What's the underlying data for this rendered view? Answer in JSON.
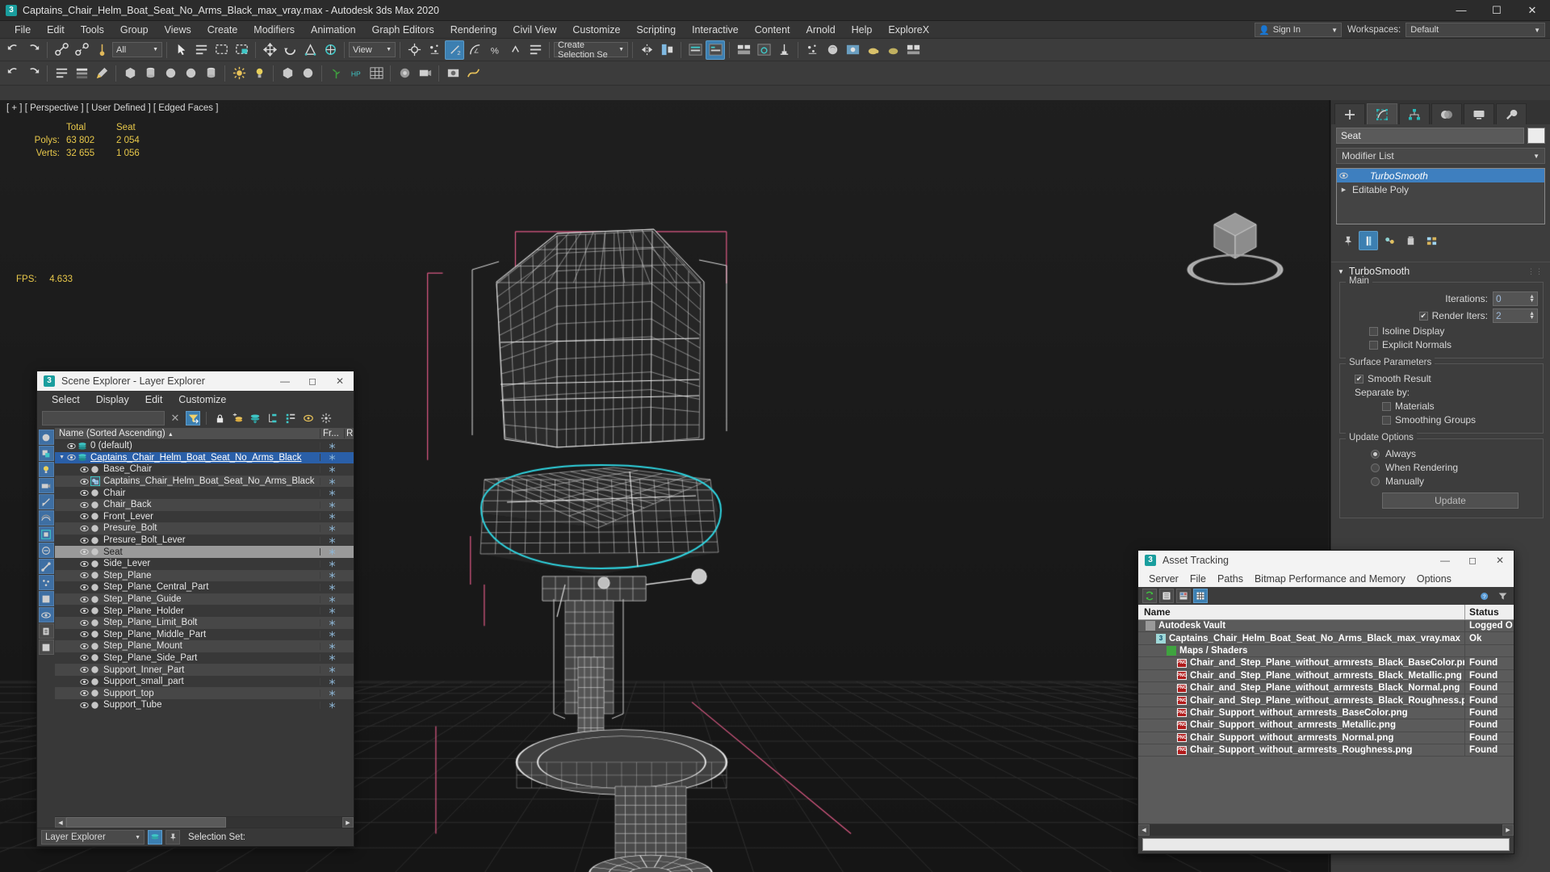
{
  "titlebar": {
    "title": "Captains_Chair_Helm_Boat_Seat_No_Arms_Black_max_vray.max - Autodesk 3ds Max 2020",
    "app_icon": "3",
    "minimize": "—",
    "maximize": "☐",
    "close": "✕"
  },
  "menubar": {
    "items": [
      "File",
      "Edit",
      "Tools",
      "Group",
      "Views",
      "Create",
      "Modifiers",
      "Animation",
      "Graph Editors",
      "Rendering",
      "Civil View",
      "Customize",
      "Scripting",
      "Interactive",
      "Content",
      "Arnold",
      "Help",
      "ExploreX"
    ],
    "signin": "Sign In",
    "workspaces_label": "Workspaces:",
    "workspace_value": "Default"
  },
  "toolbar": {
    "selection_filter": "All",
    "view_ref": "View",
    "named_selection_set": "Create Selection Se"
  },
  "viewport": {
    "label": "[ + ] [ Perspective ] [ User Defined ] [ Edged Faces ]",
    "stats": {
      "col_total": "Total",
      "col_object": "Seat",
      "polys_label": "Polys:",
      "polys_total": "63 802",
      "polys_object": "2 054",
      "verts_label": "Verts:",
      "verts_total": "32 655",
      "verts_object": "1 056",
      "fps_label": "FPS:",
      "fps_value": "4.633"
    }
  },
  "command_panel": {
    "object_name": "Seat",
    "modifier_list": "Modifier List",
    "stack": [
      {
        "label": "TurboSmooth",
        "selected": true
      },
      {
        "label": "Editable Poly",
        "selected": false
      }
    ],
    "rollout": {
      "title": "TurboSmooth",
      "main_group": "Main",
      "iterations_label": "Iterations:",
      "iterations_value": "0",
      "render_iters_label": "Render Iters:",
      "render_iters_value": "2",
      "render_iters_checked": true,
      "isoline_display": "Isoline Display",
      "explicit_normals": "Explicit Normals",
      "surface_group": "Surface Parameters",
      "smooth_result": "Smooth Result",
      "smooth_result_checked": true,
      "separate_by": "Separate by:",
      "materials": "Materials",
      "smoothing_groups": "Smoothing Groups",
      "update_group": "Update Options",
      "update_always": "Always",
      "update_when_rendering": "When Rendering",
      "update_manually": "Manually",
      "update_selected": "Always",
      "update_button": "Update"
    }
  },
  "scene_explorer": {
    "title": "Scene Explorer - Layer Explorer",
    "menu": [
      "Select",
      "Display",
      "Edit",
      "Customize"
    ],
    "search_value": "",
    "column_name": "Name (Sorted Ascending)",
    "column_freeze": "Fr...",
    "column_render": "R",
    "rows": [
      {
        "name": "0 (default)",
        "indent": 1,
        "type": "layer",
        "state": "normal"
      },
      {
        "name": "Captains_Chair_Helm_Boat_Seat_No_Arms_Black",
        "indent": 1,
        "type": "layer",
        "state": "selected-blue",
        "expanded": true
      },
      {
        "name": "Base_Chair",
        "indent": 2,
        "type": "object",
        "state": "normal"
      },
      {
        "name": "Captains_Chair_Helm_Boat_Seat_No_Arms_Black",
        "indent": 2,
        "type": "group",
        "state": "normal"
      },
      {
        "name": "Chair",
        "indent": 2,
        "type": "object",
        "state": "normal"
      },
      {
        "name": "Chair_Back",
        "indent": 2,
        "type": "object",
        "state": "normal"
      },
      {
        "name": "Front_Lever",
        "indent": 2,
        "type": "object",
        "state": "normal"
      },
      {
        "name": "Presure_Bolt",
        "indent": 2,
        "type": "object",
        "state": "normal"
      },
      {
        "name": "Presure_Bolt_Lever",
        "indent": 2,
        "type": "object",
        "state": "normal"
      },
      {
        "name": "Seat",
        "indent": 2,
        "type": "object",
        "state": "selected"
      },
      {
        "name": "Side_Lever",
        "indent": 2,
        "type": "object",
        "state": "normal"
      },
      {
        "name": "Step_Plane",
        "indent": 2,
        "type": "object",
        "state": "normal"
      },
      {
        "name": "Step_Plane_Central_Part",
        "indent": 2,
        "type": "object",
        "state": "normal"
      },
      {
        "name": "Step_Plane_Guide",
        "indent": 2,
        "type": "object",
        "state": "normal"
      },
      {
        "name": "Step_Plane_Holder",
        "indent": 2,
        "type": "object",
        "state": "normal"
      },
      {
        "name": "Step_Plane_Limit_Bolt",
        "indent": 2,
        "type": "object",
        "state": "normal"
      },
      {
        "name": "Step_Plane_Middle_Part",
        "indent": 2,
        "type": "object",
        "state": "normal"
      },
      {
        "name": "Step_Plane_Mount",
        "indent": 2,
        "type": "object",
        "state": "normal"
      },
      {
        "name": "Step_Plane_Side_Part",
        "indent": 2,
        "type": "object",
        "state": "normal"
      },
      {
        "name": "Support_Inner_Part",
        "indent": 2,
        "type": "object",
        "state": "normal"
      },
      {
        "name": "Support_small_part",
        "indent": 2,
        "type": "object",
        "state": "normal"
      },
      {
        "name": "Support_top",
        "indent": 2,
        "type": "object",
        "state": "normal"
      },
      {
        "name": "Support_Tube",
        "indent": 2,
        "type": "object",
        "state": "normal"
      }
    ],
    "footer_combo": "Layer Explorer",
    "footer_selection_set": "Selection Set:"
  },
  "asset_tracking": {
    "title": "Asset Tracking",
    "menu": [
      "Server",
      "File",
      "Paths",
      "Bitmap Performance and Memory",
      "Options"
    ],
    "col_name": "Name",
    "col_status": "Status",
    "rows": [
      {
        "name": "Autodesk Vault",
        "status": "Logged O",
        "indent": 1,
        "icon": "vault"
      },
      {
        "name": "Captains_Chair_Helm_Boat_Seat_No_Arms_Black_max_vray.max",
        "status": "Ok",
        "indent": 2,
        "icon": "max"
      },
      {
        "name": "Maps / Shaders",
        "status": "",
        "indent": 3,
        "icon": "maps"
      },
      {
        "name": "Chair_and_Step_Plane_without_armrests_Black_BaseColor.png",
        "status": "Found",
        "indent": 4,
        "icon": "png"
      },
      {
        "name": "Chair_and_Step_Plane_without_armrests_Black_Metallic.png",
        "status": "Found",
        "indent": 4,
        "icon": "png"
      },
      {
        "name": "Chair_and_Step_Plane_without_armrests_Black_Normal.png",
        "status": "Found",
        "indent": 4,
        "icon": "png"
      },
      {
        "name": "Chair_and_Step_Plane_without_armrests_Black_Roughness.png",
        "status": "Found",
        "indent": 4,
        "icon": "png"
      },
      {
        "name": "Chair_Support_without_armrests_BaseColor.png",
        "status": "Found",
        "indent": 4,
        "icon": "png"
      },
      {
        "name": "Chair_Support_without_armrests_Metallic.png",
        "status": "Found",
        "indent": 4,
        "icon": "png"
      },
      {
        "name": "Chair_Support_without_armrests_Normal.png",
        "status": "Found",
        "indent": 4,
        "icon": "png"
      },
      {
        "name": "Chair_Support_without_armrests_Roughness.png",
        "status": "Found",
        "indent": 4,
        "icon": "png"
      }
    ]
  },
  "colors": {
    "accent_blue": "#3c7fb1",
    "selection_cyan": "#2fd4e0",
    "gizmo_pink": "#e05a86",
    "stats_yellow": "#e8c84a",
    "panel_bg": "#3d3d3d",
    "viewport_bg": "#1c1c1c"
  }
}
